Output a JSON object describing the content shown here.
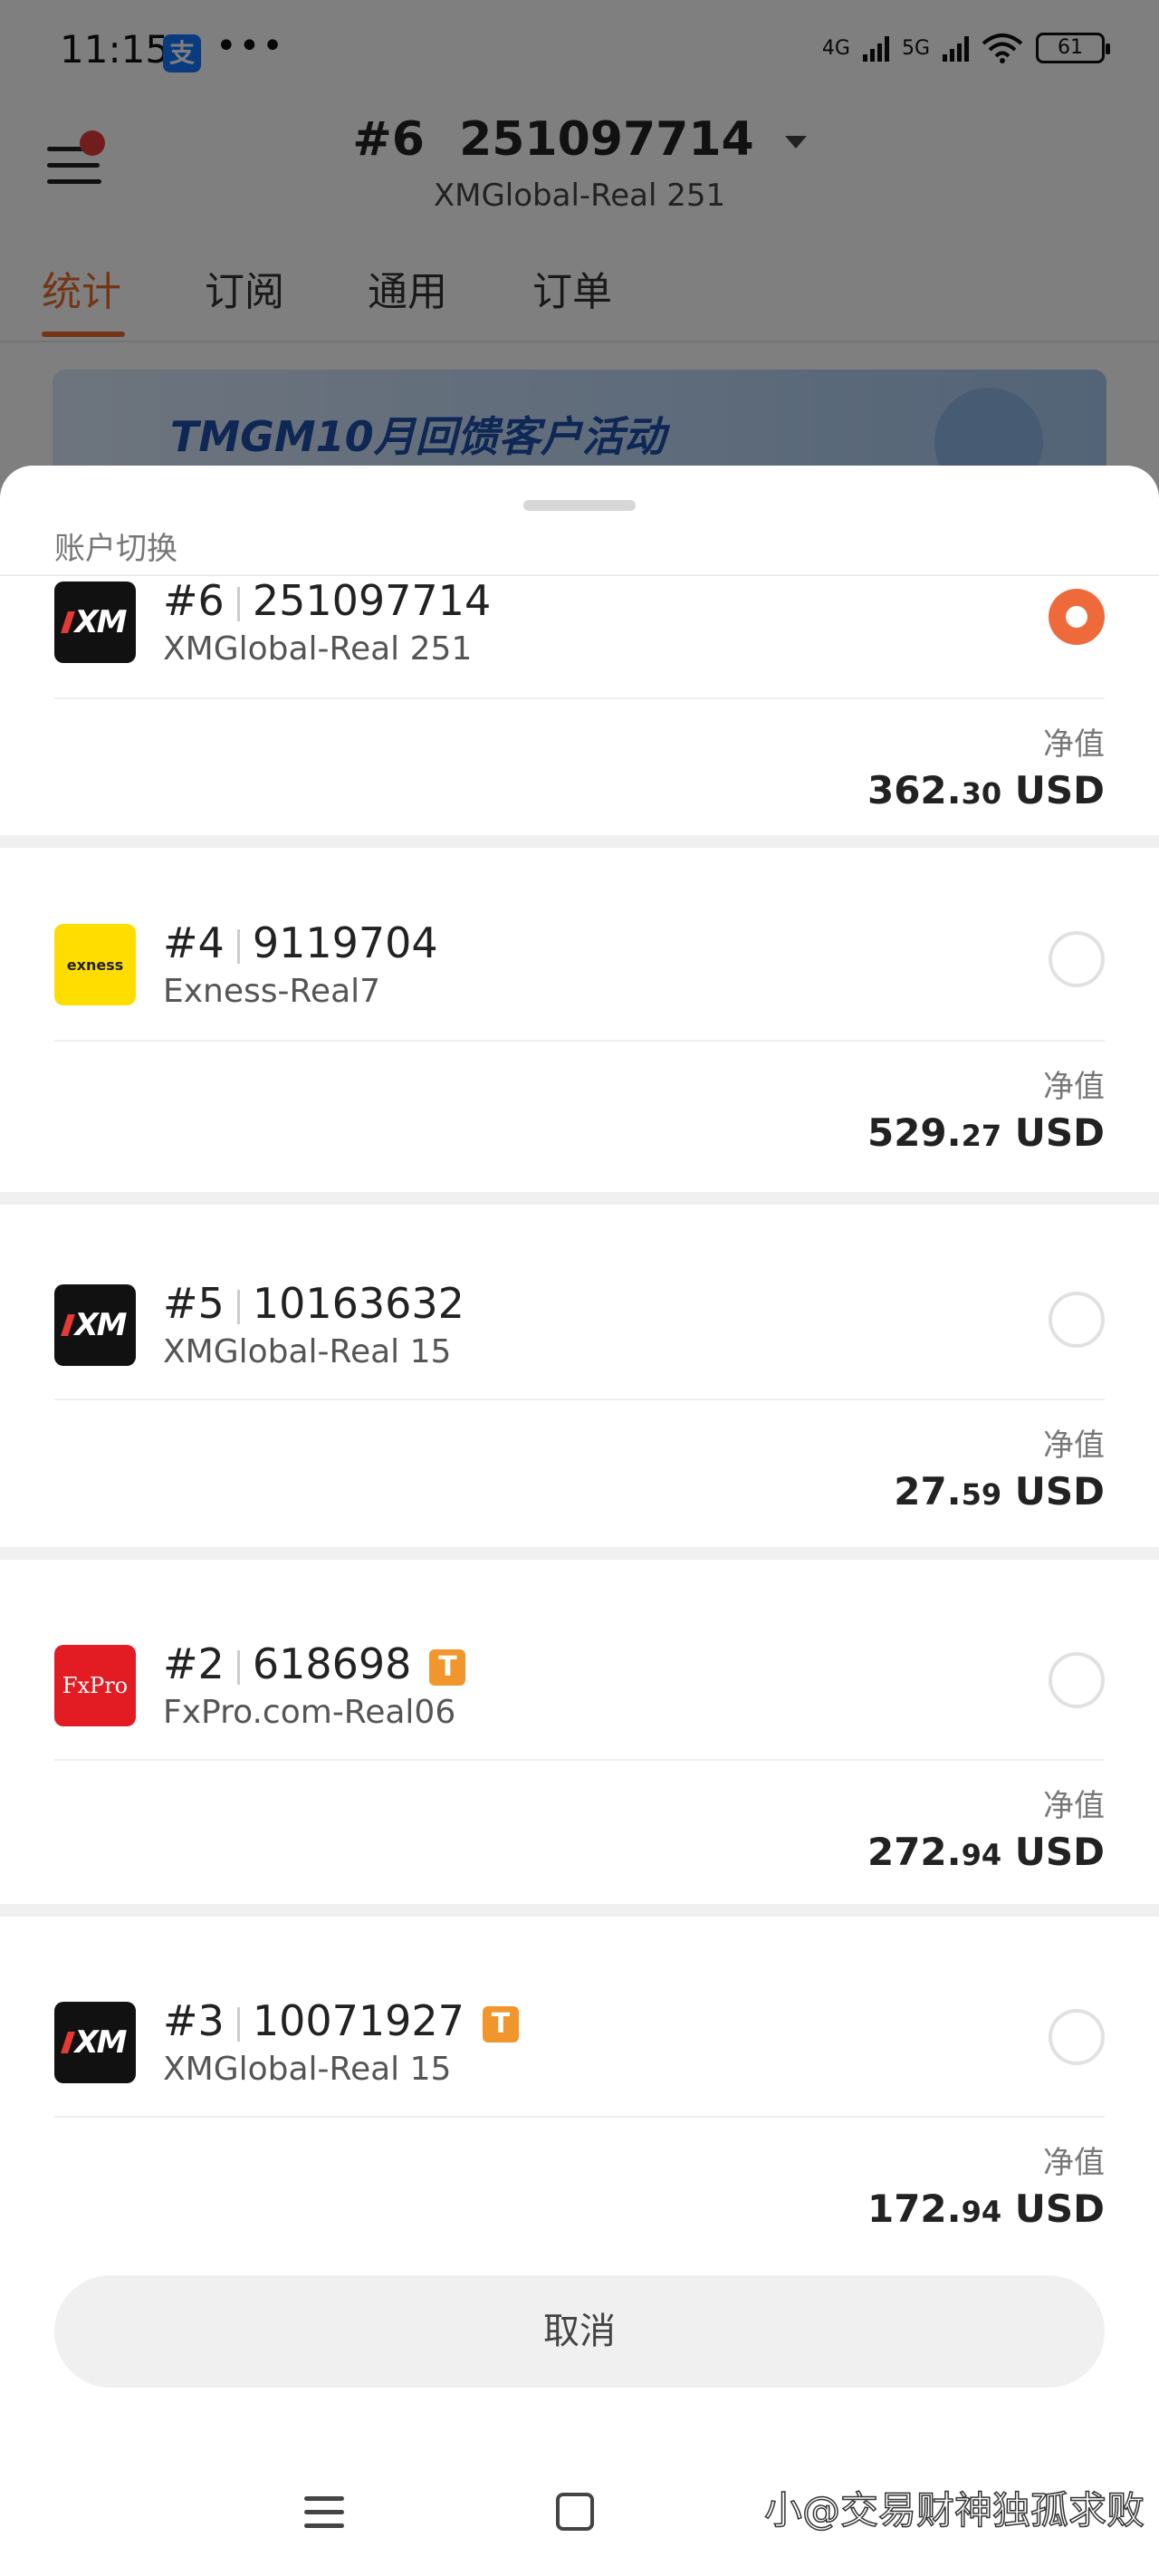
{
  "status_bar": {
    "time": "11:15",
    "alipay_glyph": "支",
    "more": "•••",
    "net1": "4G",
    "net2": "5G",
    "battery": "61"
  },
  "header": {
    "account_no": "#6",
    "account_id": "251097714",
    "server": "XMGlobal-Real 251"
  },
  "tabs": [
    "统计",
    "订阅",
    "通用",
    "订单"
  ],
  "banner": {
    "text": "TMGM10月回馈客户活动"
  },
  "sheet": {
    "title": "账户切换",
    "equity_label": "净值",
    "cancel": "取消",
    "accounts": [
      {
        "no": "#6",
        "id": "251097714",
        "server": "XMGlobal-Real 251",
        "equity_int": "362.",
        "equity_dec": "30",
        "currency": "USD",
        "logo": "XM",
        "selected": true,
        "badge": ""
      },
      {
        "no": "#4",
        "id": "9119704",
        "server": "Exness-Real7",
        "equity_int": "529.",
        "equity_dec": "27",
        "currency": "USD",
        "logo": "exness",
        "selected": false,
        "badge": ""
      },
      {
        "no": "#5",
        "id": "10163632",
        "server": "XMGlobal-Real 15",
        "equity_int": "27.",
        "equity_dec": "59",
        "currency": "USD",
        "logo": "XM",
        "selected": false,
        "badge": ""
      },
      {
        "no": "#2",
        "id": "618698",
        "server": "FxPro.com-Real06",
        "equity_int": "272.",
        "equity_dec": "94",
        "currency": "USD",
        "logo": "FxPro",
        "selected": false,
        "badge": "T"
      },
      {
        "no": "#3",
        "id": "10071927",
        "server": "XMGlobal-Real 15",
        "equity_int": "172.",
        "equity_dec": "94",
        "currency": "USD",
        "logo": "XM",
        "selected": false,
        "badge": "T"
      }
    ]
  },
  "watermark": "小@交易财神独孤求败",
  "colors": {
    "accent": "#e86a2f",
    "radio_selected": "#ef6a3a",
    "badge": "#f0962c"
  }
}
